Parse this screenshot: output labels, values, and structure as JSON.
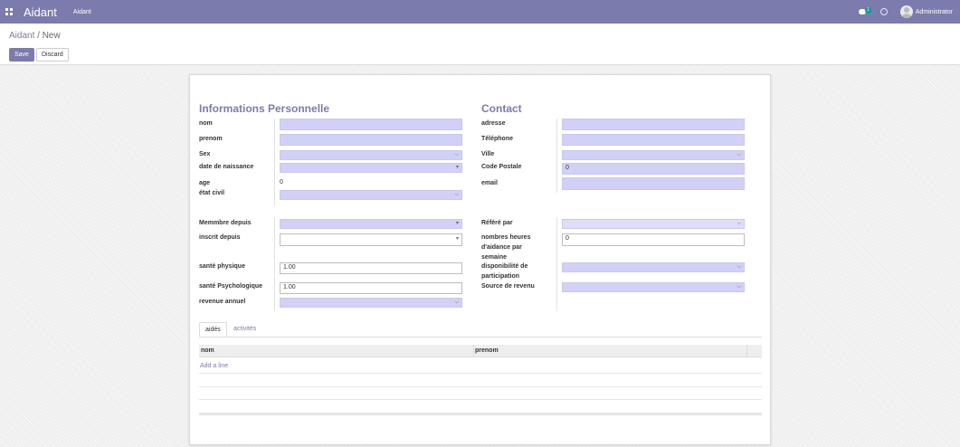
{
  "navbar": {
    "brand": "Aidant",
    "menu_item": "Aidant",
    "chat_badge": "1",
    "user": "Administrator"
  },
  "breadcrumb": {
    "parent": "Aidant",
    "separator": "/",
    "current": "New"
  },
  "buttons": {
    "save": "Save",
    "discard": "Discard"
  },
  "personal": {
    "title": "Informations Personnelle",
    "nom_label": "nom",
    "prenom_label": "prenom",
    "sex_label": "Sex",
    "dob_label": "date de naissance",
    "age_label": "age",
    "age_value": "0",
    "etat_label": "état civil"
  },
  "contact": {
    "title": "Contact",
    "adresse_label": "adresse",
    "telephone_label": "Téléphone",
    "ville_label": "Ville",
    "code_postale_label": "Code Postale",
    "code_postale_value": "0",
    "email_label": "email"
  },
  "membership": {
    "membre_label": "Memmbre depuis",
    "inscrit_label": "inscrit depuis",
    "sante_physique_label": "santé physique",
    "sante_physique_value": "1.00",
    "sante_psy_label": "santé Psychologique",
    "sante_psy_value": "1.00",
    "revenue_label": "revenue annuel"
  },
  "reference": {
    "refere_label": "Référé par",
    "heures_label_1": "nombres heures",
    "heures_label_2": "d'aidance par",
    "heures_label_3": "semaine",
    "heures_value": "0",
    "dispo_label_1": "disponibilité de",
    "dispo_label_2": "participation",
    "source_label": "Source de revenu"
  },
  "notebook": {
    "tabs": [
      "aidés",
      "activités"
    ],
    "columns": [
      "nom",
      "prenom"
    ],
    "add_line": "Add a line"
  },
  "colors": {
    "brand": "#7c7bad",
    "required_field": "#d1d1f8"
  }
}
